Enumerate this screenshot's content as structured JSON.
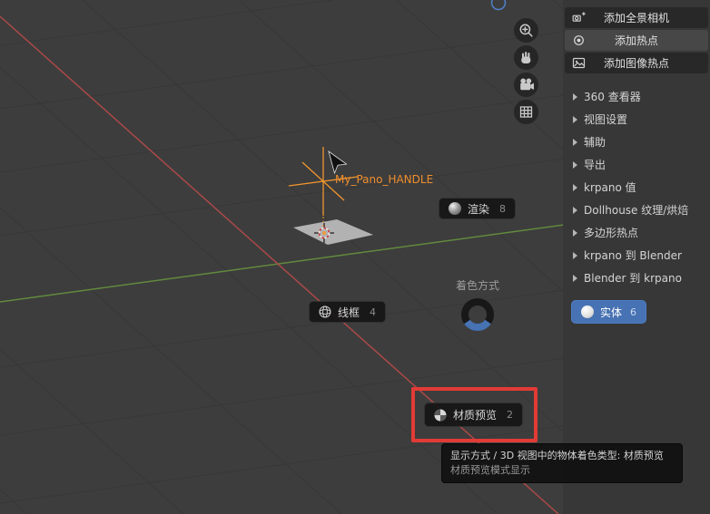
{
  "colors": {
    "viewport_bg": "#3d3d3d",
    "selection_blue": "#4772b3",
    "object_orange": "#ef8e2d",
    "annotation_red": "#e23b36",
    "axis_x_red": "#b84a4a",
    "axis_y_green": "#6b9e3e"
  },
  "scene": {
    "handle_label": "My_Pano_HANDLE"
  },
  "nav_gizmos": [
    {
      "icon": "zoom-in-icon"
    },
    {
      "icon": "pan-hand-icon"
    },
    {
      "icon": "camera-view-icon"
    },
    {
      "icon": "grid-ortho-icon"
    }
  ],
  "sidebar": {
    "buttons": [
      {
        "label": "添加全景相机",
        "icon": "pano-camera-icon"
      },
      {
        "label": "添加热点",
        "icon": "hotspot-icon"
      },
      {
        "label": "添加图像热点",
        "icon": "image-hotspot-icon"
      }
    ],
    "sections": [
      "360 查看器",
      "视图设置",
      "辅助",
      "导出",
      "krpano 值",
      "Dollhouse 纹理/烘焙",
      "多边形热点",
      "krpano 到 Blender",
      "Blender 到 krpano"
    ]
  },
  "pie_menu": {
    "title": "着色方式",
    "items": [
      {
        "label": "渲染",
        "badge": "8",
        "icon": "render-sphere-icon"
      },
      {
        "label": "线框",
        "badge": "4",
        "icon": "wireframe-sphere-icon"
      },
      {
        "label": "实体",
        "badge": "6",
        "icon": "solid-sphere-icon",
        "selected": true
      },
      {
        "label": "材质预览",
        "badge": "2",
        "icon": "material-sphere-icon"
      }
    ]
  },
  "tooltip": {
    "line1": "显示方式 / 3D 视图中的物体着色类型: 材质预览",
    "line2": "材质预览模式显示"
  }
}
